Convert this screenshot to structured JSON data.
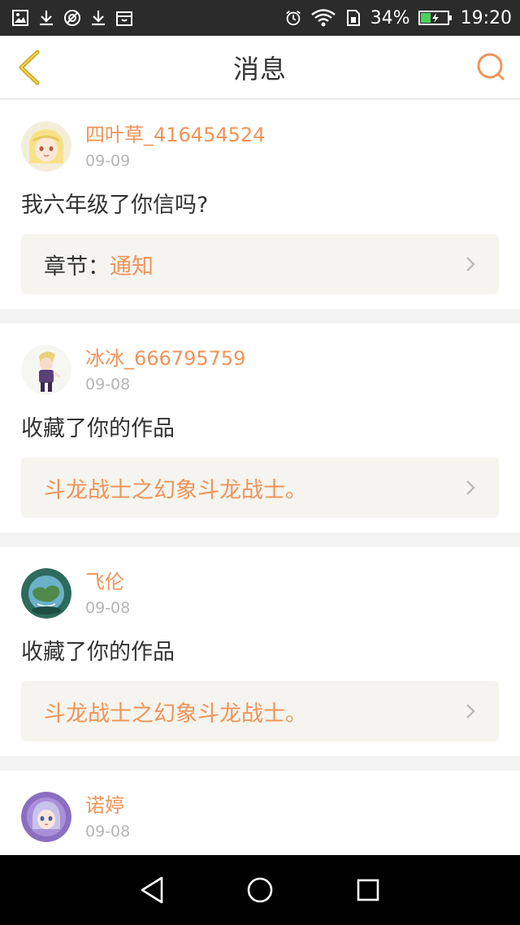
{
  "status_bar": {
    "battery": "34%",
    "time": "19:20"
  },
  "header": {
    "title": "消息"
  },
  "messages": [
    {
      "user": "四叶草_416454524",
      "date": "09-09",
      "text": "我六年级了你信吗?",
      "link_label": "章节：",
      "link_value": "通知"
    },
    {
      "user": "冰冰_666795759",
      "date": "09-08",
      "text": "收藏了你的作品",
      "link_value": "斗龙战士之幻象斗龙战士。"
    },
    {
      "user": "飞伦",
      "date": "09-08",
      "text": "收藏了你的作品",
      "link_value": "斗龙战士之幻象斗龙战士。"
    },
    {
      "user": "诺婷",
      "date": "09-08"
    }
  ],
  "colors": {
    "accent": "#f0945a",
    "link_bg": "#f5f4ee",
    "status_bar": "#2b2b2b",
    "nav_bar": "#000000"
  }
}
